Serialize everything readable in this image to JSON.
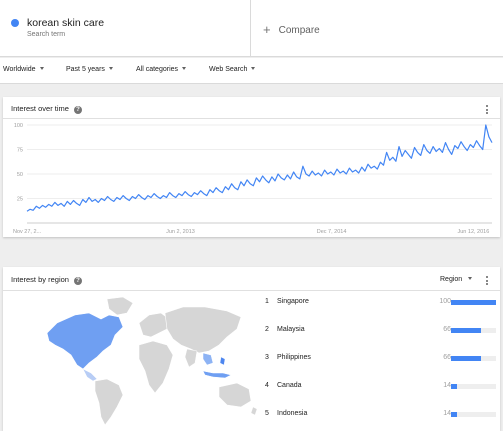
{
  "search": {
    "term": "korean skin care",
    "term_sub": "Search term",
    "compare_label": "Compare",
    "term_color": "#4285f4"
  },
  "filters": {
    "geo": "Worldwide",
    "time": "Past 5 years",
    "category": "All categories",
    "search_type": "Web Search"
  },
  "interest_over_time": {
    "title": "Interest over time",
    "accent": "#4285f4"
  },
  "chart_data": {
    "type": "line",
    "x_tick_labels": [
      "Nov 27, 2...",
      "Jun 2, 2013",
      "Dec 7, 2014",
      "Jun 12, 2016"
    ],
    "y_tick_labels": [
      "100",
      "75",
      "50",
      "25"
    ],
    "ylim": [
      0,
      100
    ],
    "grid": true,
    "series": [
      {
        "values": [
          12,
          14,
          13,
          17,
          15,
          18,
          16,
          19,
          17,
          21,
          18,
          20,
          17,
          22,
          19,
          23,
          20,
          18,
          24,
          21,
          26,
          22,
          24,
          21,
          25,
          23,
          27,
          24,
          22,
          26,
          24,
          28,
          25,
          23,
          27,
          25,
          29,
          26,
          24,
          28,
          26,
          30,
          27,
          25,
          28,
          26,
          31,
          28,
          26,
          30,
          28,
          32,
          29,
          27,
          31,
          29,
          33,
          30,
          28,
          34,
          31,
          36,
          33,
          31,
          37,
          34,
          40,
          36,
          34,
          42,
          38,
          44,
          40,
          38,
          46,
          42,
          48,
          44,
          41,
          47,
          43,
          50,
          46,
          44,
          49,
          45,
          52,
          47,
          45,
          58,
          50,
          48,
          53,
          49,
          51,
          48,
          54,
          50,
          52,
          49,
          55,
          51,
          53,
          50,
          56,
          52,
          54,
          51,
          57,
          53,
          60,
          56,
          58,
          55,
          62,
          59,
          72,
          64,
          67,
          63,
          78,
          68,
          74,
          70,
          66,
          77,
          72,
          69,
          80,
          74,
          71,
          78,
          73,
          76,
          72,
          82,
          75,
          70,
          79,
          76,
          83,
          78,
          74,
          80,
          77,
          84,
          79,
          75,
          100,
          88,
          82
        ]
      }
    ]
  },
  "interest_by_region": {
    "title": "Interest by region",
    "region_select": "Region",
    "rows": [
      {
        "rank": "1",
        "name": "Singapore",
        "value": "100",
        "pct": 100
      },
      {
        "rank": "2",
        "name": "Malaysia",
        "value": "66",
        "pct": 66
      },
      {
        "rank": "3",
        "name": "Philippines",
        "value": "66",
        "pct": 66
      },
      {
        "rank": "4",
        "name": "Canada",
        "value": "14",
        "pct": 14
      },
      {
        "rank": "5",
        "name": "Indonesia",
        "value": "14",
        "pct": 14
      }
    ]
  }
}
